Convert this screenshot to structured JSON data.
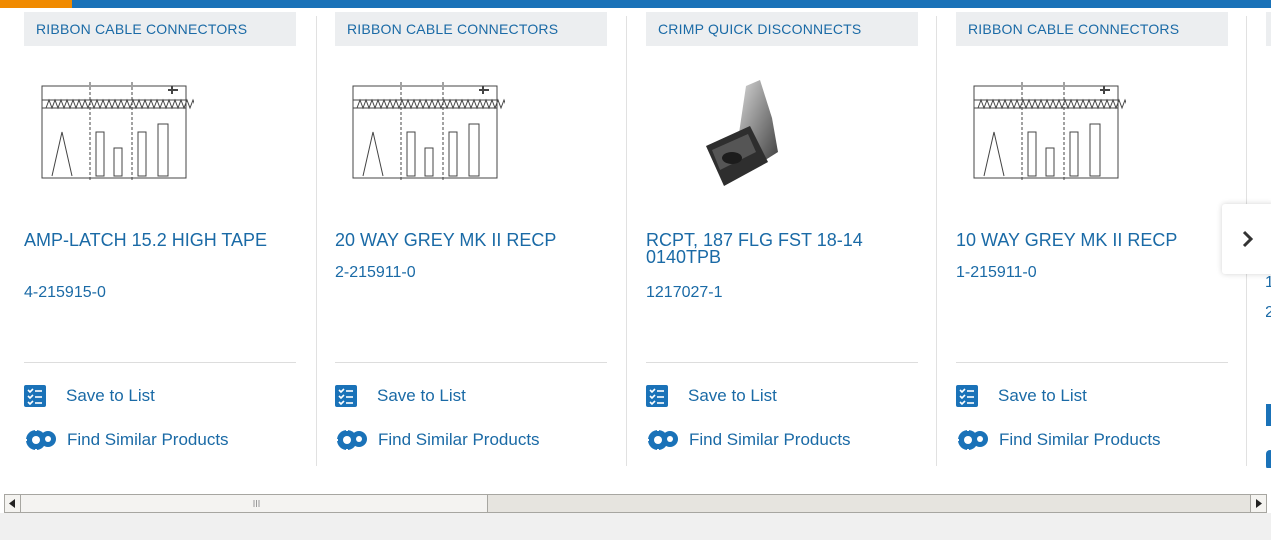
{
  "colors": {
    "brand_blue": "#1a72b8",
    "accent_orange": "#f08a00",
    "link_blue": "#1a6aa6"
  },
  "cards": [
    {
      "category": "RIBBON CABLE CONNECTORS",
      "title": "AMP-LATCH 15.2 HIGH TAPE",
      "part_number": "4-215915-0",
      "image": "ribbon-connector-drawing",
      "save_label": "Save to List",
      "similar_label": "Find Similar Products"
    },
    {
      "category": "RIBBON CABLE CONNECTORS",
      "title": "20 WAY GREY MK II RECP",
      "part_number": "2-215911-0",
      "image": "ribbon-connector-drawing",
      "save_label": "Save to List",
      "similar_label": "Find Similar Products"
    },
    {
      "category": "CRIMP QUICK DISCONNECTS",
      "title": "RCPT, 187 FLG FST 18-14 0140TPB",
      "part_number": "1217027-1",
      "image": "quick-disconnect-photo",
      "save_label": "Save to List",
      "similar_label": "Find Similar Products"
    },
    {
      "category": "RIBBON CABLE CONNECTORS",
      "title": "10 WAY GREY MK II RECP",
      "part_number": "1-215911-0",
      "image": "ribbon-connector-drawing",
      "save_label": "Save to List",
      "similar_label": "Find Similar Products"
    }
  ],
  "partial_card": {
    "title_fragment": "1",
    "pn_fragment": "2"
  },
  "icons": {
    "next": "chevron-right-icon",
    "save": "list-icon",
    "similar": "gears-icon"
  }
}
